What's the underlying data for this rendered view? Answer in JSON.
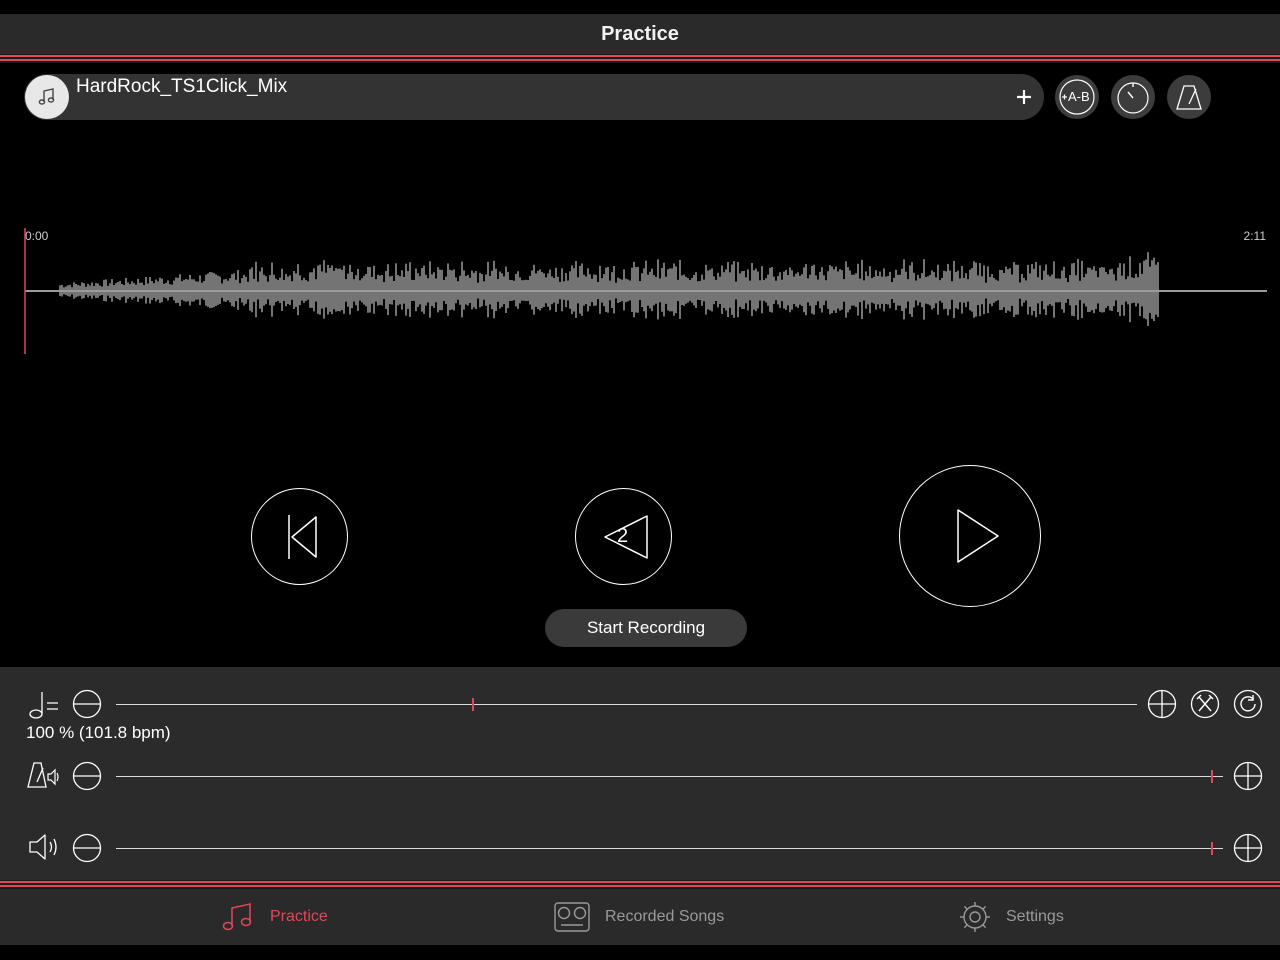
{
  "header": {
    "title": "Practice"
  },
  "song": {
    "title": "HardRock_TS1Click_Mix",
    "icon": "music-note-icon"
  },
  "toolbar": {
    "add_icon": "plus-icon",
    "ab_loop_label": "A-B",
    "ab_loop_icon": "ab-loop-icon",
    "timer_icon": "timer-icon",
    "metronome_icon": "metronome-icon"
  },
  "waveform": {
    "time_start": "0:00",
    "time_end": "2:11",
    "playhead_color": "#e0475b",
    "wave_color": "#9a9a9a"
  },
  "transport": {
    "rewind_icon": "skip-to-start-icon",
    "countdown_label": "2",
    "countdown_icon": "count-in-icon",
    "play_icon": "play-icon",
    "record_label": "Start Recording"
  },
  "controls": {
    "tempo": {
      "readout": "100 % (101.8 bpm)",
      "level": 0.35,
      "icon": "tempo-note-icon"
    },
    "click_volume": {
      "level": 0.99,
      "icon": "metronome-volume-icon"
    },
    "song_volume": {
      "level": 0.99,
      "icon": "speaker-icon"
    },
    "tempo_tools": [
      "tuning-fork-icon",
      "reset-icon"
    ]
  },
  "tabs": [
    {
      "label": "Practice",
      "icon": "music-note-icon",
      "active": true
    },
    {
      "label": "Recorded Songs",
      "icon": "tape-recorder-icon",
      "active": false
    },
    {
      "label": "Settings",
      "icon": "gear-icon",
      "active": false
    }
  ],
  "colors": {
    "accent": "#e0475b",
    "panel": "#2b2b2b",
    "background": "#000000"
  }
}
